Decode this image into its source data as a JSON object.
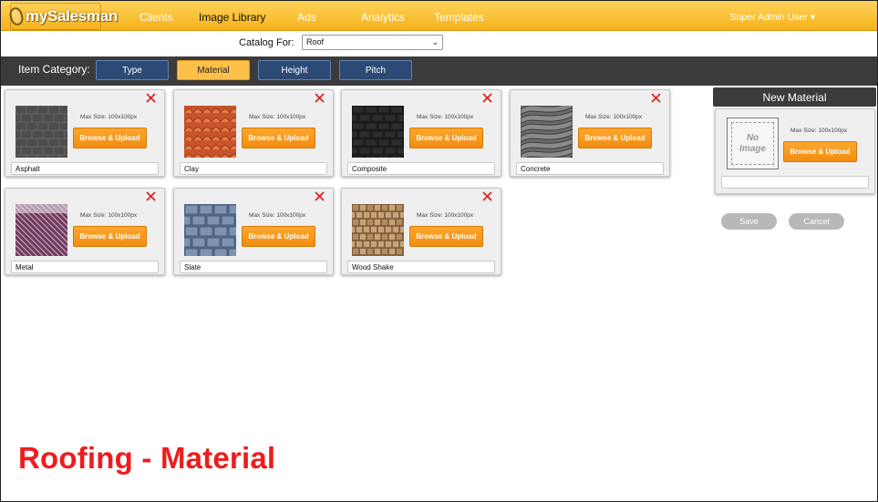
{
  "app": {
    "logo_text": "mySalesman",
    "nav": [
      "Clients",
      "Image Library",
      "Ads",
      "Analytics",
      "Templates"
    ],
    "active_nav": "Image Library",
    "user_menu": "Super Admin User ▾"
  },
  "catalog": {
    "label": "Catalog For:",
    "selected": "Roof",
    "chevron": "⌄"
  },
  "category": {
    "label": "Item Category:",
    "tabs": [
      "Type",
      "Material",
      "Height",
      "Pitch"
    ],
    "active": "Material"
  },
  "materials": [
    {
      "name": "Asphalt",
      "max_size": "Max Size: 100x100px",
      "button": "Browse & Upload",
      "swatch": "asphalt"
    },
    {
      "name": "Clay",
      "max_size": "Max Size: 100x100px",
      "button": "Browse & Upload",
      "swatch": "clay"
    },
    {
      "name": "Composite",
      "max_size": "Max Size: 100x100px",
      "button": "Browse & Upload",
      "swatch": "composite"
    },
    {
      "name": "Concrete",
      "max_size": "Max Size: 100x100px",
      "button": "Browse & Upload",
      "swatch": "concrete"
    },
    {
      "name": "Metal",
      "max_size": "Max Size: 100x100px",
      "button": "Browse & Upload",
      "swatch": "metal"
    },
    {
      "name": "Slate",
      "max_size": "Max Size: 100x100px",
      "button": "Browse & Upload",
      "swatch": "slate"
    },
    {
      "name": "Wood Shake",
      "max_size": "Max Size: 100x100px",
      "button": "Browse & Upload",
      "swatch": "wood-shake"
    }
  ],
  "new_material": {
    "header": "New Material",
    "placeholder_line1": "No",
    "placeholder_line2": "Image",
    "max_size": "Max Size: 100x100px",
    "button": "Browse & Upload",
    "name_value": "",
    "save": "Save",
    "cancel": "Cancel"
  },
  "caption": "Roofing - Material",
  "colors": {
    "header_bg": "#f6b21c",
    "category_bar": "#3b3b3b",
    "tab_bg": "#2c4a75",
    "tab_active": "#ffc04a",
    "upload_button": "#f28d10",
    "close_icon": "#e02020",
    "caption": "#ee1c1c"
  }
}
